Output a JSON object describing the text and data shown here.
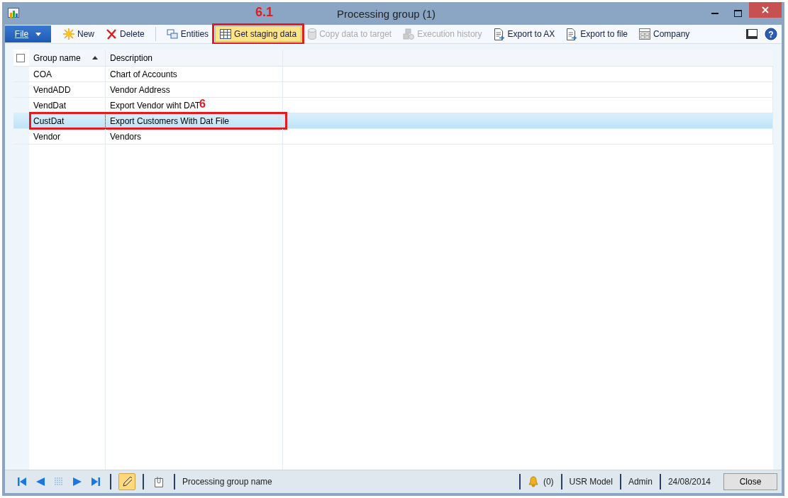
{
  "window": {
    "title": "Processing group (1)",
    "annotation": "6.1"
  },
  "toolbar": {
    "file_menu": "File",
    "help": "?",
    "buttons": [
      {
        "label": "New",
        "disabled": false,
        "highlighted": false
      },
      {
        "label": "Delete",
        "disabled": false,
        "highlighted": false
      },
      {
        "label": "Entities",
        "disabled": false,
        "highlighted": false
      },
      {
        "label": "Get staging data",
        "disabled": false,
        "highlighted": true
      },
      {
        "label": "Copy data to target",
        "disabled": true,
        "highlighted": false
      },
      {
        "label": "Execution history",
        "disabled": true,
        "highlighted": false
      },
      {
        "label": "Export to AX",
        "disabled": false,
        "highlighted": false
      },
      {
        "label": "Export to file",
        "disabled": false,
        "highlighted": false
      },
      {
        "label": "Company",
        "disabled": false,
        "highlighted": false
      }
    ]
  },
  "table": {
    "select_all_checked": false,
    "columns": [
      {
        "label": "Group name",
        "sorted": true
      },
      {
        "label": "Description",
        "sorted": false
      }
    ],
    "rows": [
      {
        "cells": [
          "COA",
          "Chart of Accounts"
        ],
        "selected": false
      },
      {
        "cells": [
          "VendADD",
          "Vendor Address"
        ],
        "selected": false
      },
      {
        "cells": [
          "VendDat",
          "Export Vendor wiht DAT"
        ],
        "selected": false,
        "note": "6"
      },
      {
        "cells": [
          "CustDat",
          "Export Customers With Dat File"
        ],
        "selected": true
      },
      {
        "cells": [
          "Vendor",
          "Vendors"
        ],
        "selected": false
      }
    ]
  },
  "status_bar": {
    "edit_mode": true,
    "field_name": "Processing group name",
    "notifications": "(0)",
    "model": "USR Model",
    "user": "Admin",
    "date": "24/08/2014",
    "close_button": "Close"
  }
}
